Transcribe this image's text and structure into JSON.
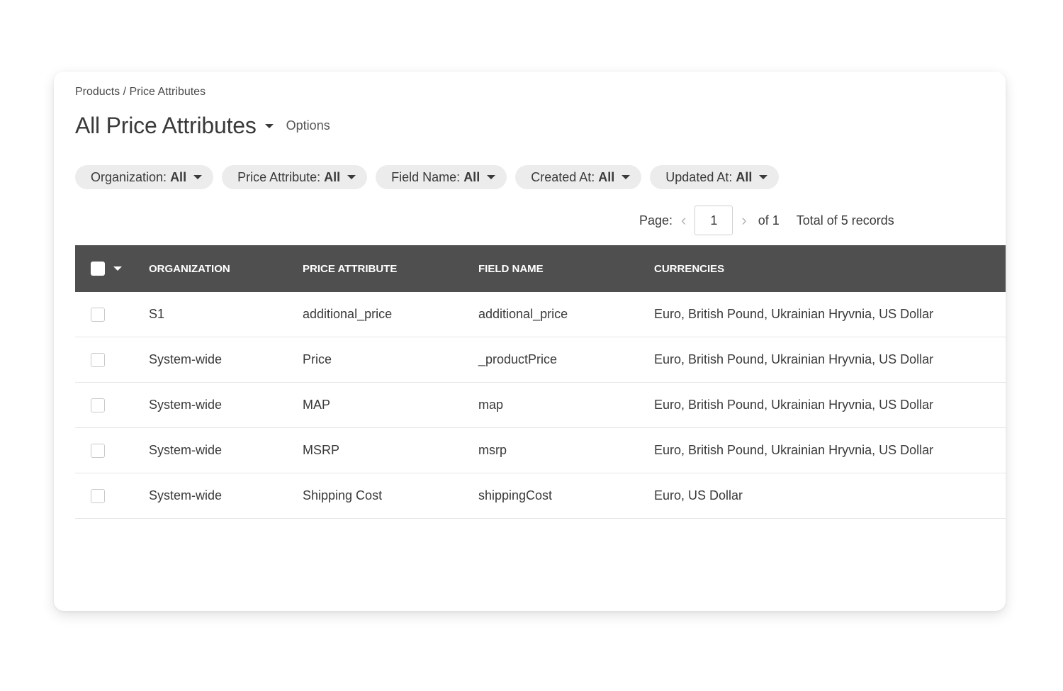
{
  "breadcrumb": "Products / Price Attributes",
  "page_title": "All Price Attributes",
  "options_label": "Options",
  "filters": [
    {
      "label": "Organization:",
      "value": "All"
    },
    {
      "label": "Price Attribute:",
      "value": "All"
    },
    {
      "label": "Field Name:",
      "value": "All"
    },
    {
      "label": "Created At:",
      "value": "All"
    },
    {
      "label": "Updated At:",
      "value": "All"
    }
  ],
  "pagination": {
    "page_label": "Page:",
    "prev_icon": "‹",
    "next_icon": "›",
    "current_page": "1",
    "of_label": "of 1",
    "total_label": "Total of 5 records"
  },
  "table": {
    "columns": [
      "ORGANIZATION",
      "PRICE ATTRIBUTE",
      "FIELD NAME",
      "CURRENCIES"
    ],
    "rows": [
      {
        "organization": "S1",
        "price_attribute": "additional_price",
        "field_name": "additional_price",
        "currencies": "Euro, British Pound, Ukrainian Hryvnia, US Dollar"
      },
      {
        "organization": "System-wide",
        "price_attribute": "Price",
        "field_name": "_productPrice",
        "currencies": "Euro, British Pound, Ukrainian Hryvnia, US Dollar"
      },
      {
        "organization": "System-wide",
        "price_attribute": "MAP",
        "field_name": "map",
        "currencies": "Euro, British Pound, Ukrainian Hryvnia, US Dollar"
      },
      {
        "organization": "System-wide",
        "price_attribute": "MSRP",
        "field_name": "msrp",
        "currencies": "Euro, British Pound, Ukrainian Hryvnia, US Dollar"
      },
      {
        "organization": "System-wide",
        "price_attribute": "Shipping Cost",
        "field_name": "shippingCost",
        "currencies": "Euro, US Dollar"
      }
    ]
  },
  "colors": {
    "table_header_bg": "#4f4f4f",
    "filter_pill_bg": "#ececec",
    "text": "#3a3a3a"
  }
}
